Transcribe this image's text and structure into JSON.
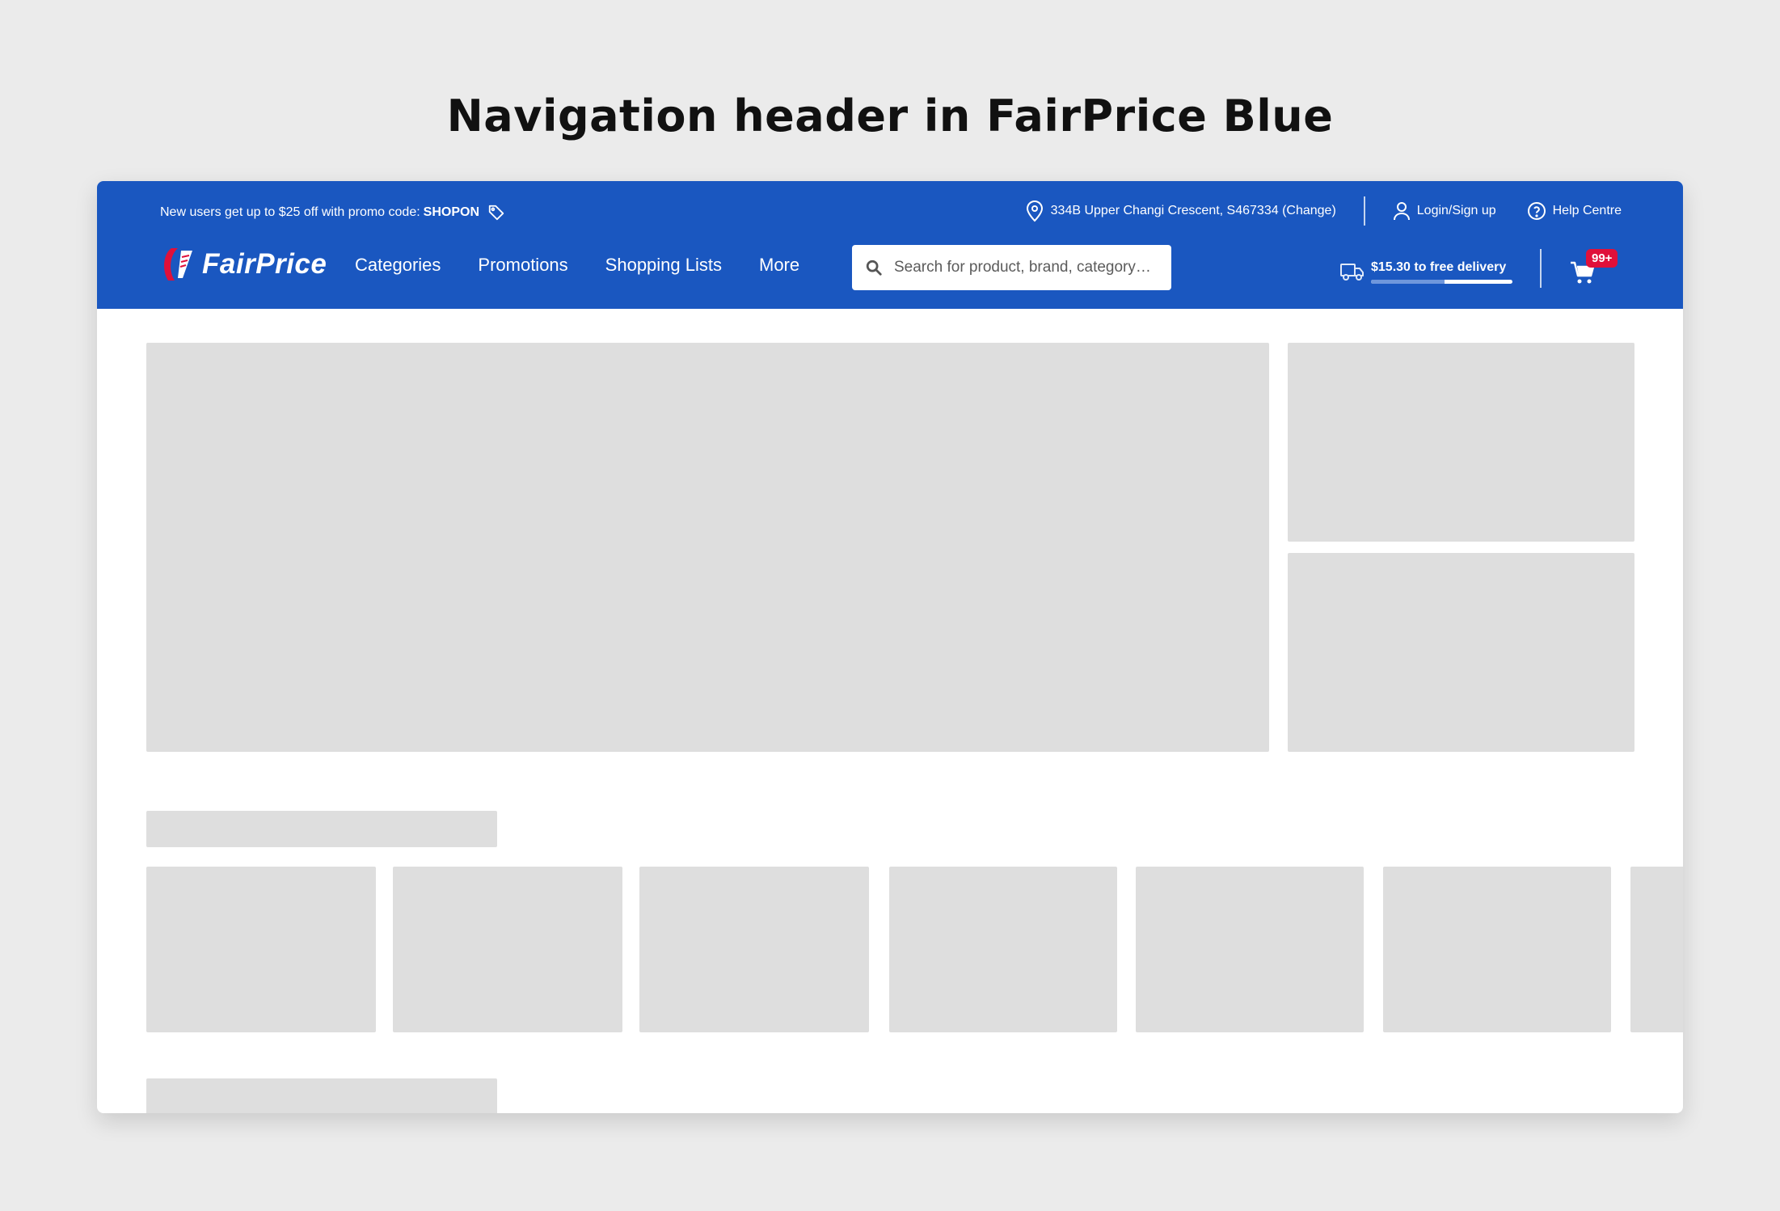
{
  "page_title": "Navigation header in FairPrice Blue",
  "colors": {
    "brand_blue": "#1a57c0",
    "badge_red": "#e0103a",
    "placeholder": "#dedede",
    "background": "#ebebeb"
  },
  "topbar": {
    "promo_text": "New users get up to $25 off with promo code:",
    "promo_code": "SHOPON",
    "address": "334B Upper Changi Crescent, S467334 (Change)",
    "login": "Login/Sign up",
    "help": "Help Centre"
  },
  "nav": {
    "logo": "FairPrice",
    "items": [
      "Categories",
      "Promotions",
      "Shopping Lists",
      "More"
    ]
  },
  "search": {
    "placeholder": "Search for product, brand, category…"
  },
  "delivery": {
    "text": "$15.30 to free delivery",
    "progress": 0.52
  },
  "cart": {
    "badge": "99+"
  },
  "icons": [
    "tag-icon",
    "location-pin-icon",
    "user-icon",
    "help-circle-icon",
    "search-icon",
    "delivery-truck-icon",
    "cart-icon",
    "fairprice-logo-icon"
  ]
}
